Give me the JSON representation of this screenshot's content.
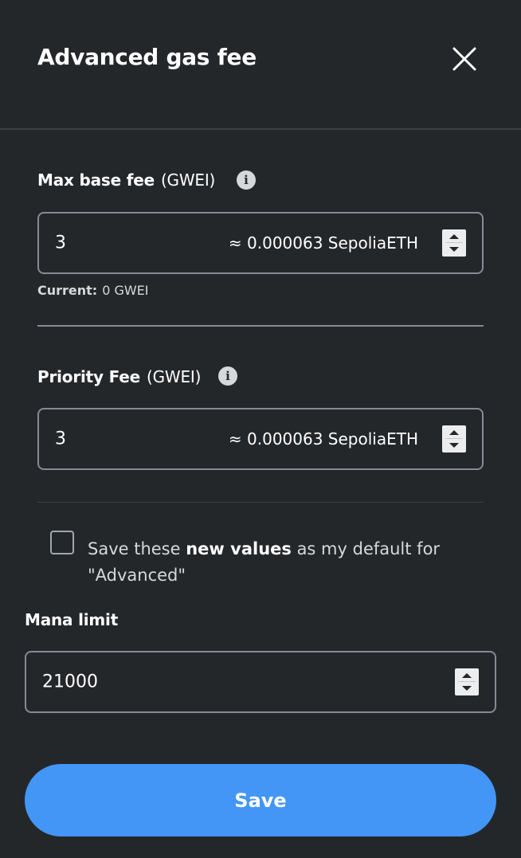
{
  "header": {
    "title": "Advanced gas fee"
  },
  "max_base_fee": {
    "label": "Max base fee",
    "unit": "(GWEI)",
    "value": "3",
    "approx": "≈ 0.000063 SepoliaETH",
    "current_label": "Current:",
    "current_value": "0 GWEI"
  },
  "priority_fee": {
    "label": "Priority Fee",
    "unit": "(GWEI)",
    "value": "3",
    "approx": "≈ 0.000063 SepoliaETH"
  },
  "default_checkbox": {
    "checked": false,
    "text_before": "Save these ",
    "text_bold": "new values",
    "text_after": " as my default for \"Advanced\""
  },
  "mana_limit": {
    "label": "Mana limit",
    "value": "21000"
  },
  "footer": {
    "save_label": "Save"
  },
  "icons": {
    "close": "close-icon",
    "info": "info-icon",
    "stepper": "stepper-arrows-icon"
  },
  "colors": {
    "background": "#24272a",
    "primary": "#4396f6",
    "border": "#858b92"
  }
}
